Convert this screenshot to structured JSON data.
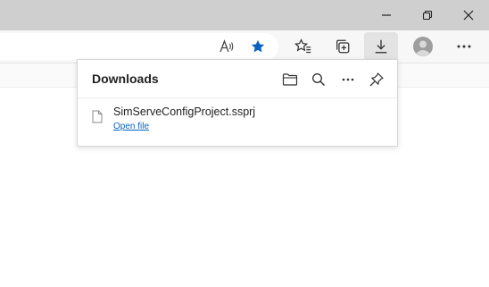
{
  "window_controls": {
    "minimize_icon": "minimize-icon",
    "restore_icon": "restore-icon",
    "close_icon": "close-icon"
  },
  "toolbar": {
    "read_aloud_icon": "read-aloud-icon",
    "favorite_icon": "star-filled-icon",
    "favorites_icon": "favorites-icon",
    "collections_icon": "collections-icon",
    "downloads_icon": "download-icon",
    "profile_icon": "profile-avatar-icon",
    "more_icon": "more-icon",
    "accent_color": "#0a63c2"
  },
  "downloads_panel": {
    "title": "Downloads",
    "open_folder_icon": "folder-icon",
    "search_icon": "search-icon",
    "more_icon": "more-icon",
    "pin_icon": "pin-icon",
    "items": [
      {
        "file_name": "SimServeConfigProject.ssprj",
        "action_label": "Open file",
        "file_icon": "file-icon"
      }
    ]
  }
}
